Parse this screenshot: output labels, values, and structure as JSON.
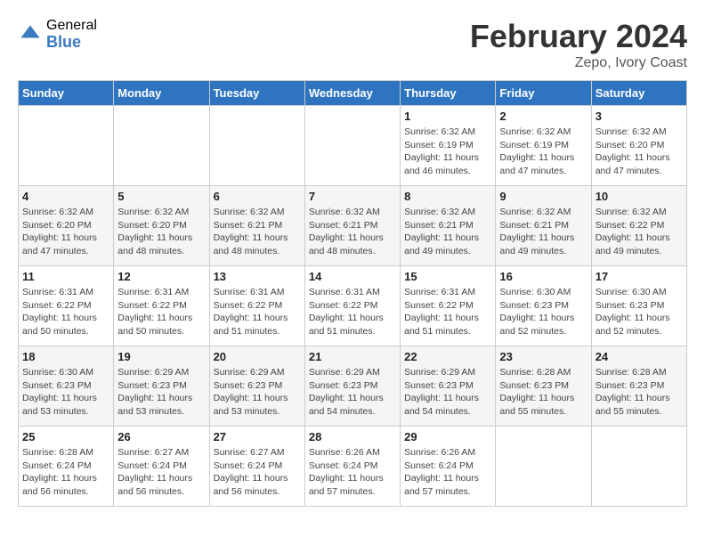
{
  "logo": {
    "general": "General",
    "blue": "Blue"
  },
  "title": {
    "month_year": "February 2024",
    "location": "Zepo, Ivory Coast"
  },
  "days_of_week": [
    "Sunday",
    "Monday",
    "Tuesday",
    "Wednesday",
    "Thursday",
    "Friday",
    "Saturday"
  ],
  "weeks": [
    [
      {
        "day": "",
        "sunrise": "",
        "sunset": "",
        "daylight": ""
      },
      {
        "day": "",
        "sunrise": "",
        "sunset": "",
        "daylight": ""
      },
      {
        "day": "",
        "sunrise": "",
        "sunset": "",
        "daylight": ""
      },
      {
        "day": "",
        "sunrise": "",
        "sunset": "",
        "daylight": ""
      },
      {
        "day": "1",
        "sunrise": "Sunrise: 6:32 AM",
        "sunset": "Sunset: 6:19 PM",
        "daylight": "Daylight: 11 hours and 46 minutes."
      },
      {
        "day": "2",
        "sunrise": "Sunrise: 6:32 AM",
        "sunset": "Sunset: 6:19 PM",
        "daylight": "Daylight: 11 hours and 47 minutes."
      },
      {
        "day": "3",
        "sunrise": "Sunrise: 6:32 AM",
        "sunset": "Sunset: 6:20 PM",
        "daylight": "Daylight: 11 hours and 47 minutes."
      }
    ],
    [
      {
        "day": "4",
        "sunrise": "Sunrise: 6:32 AM",
        "sunset": "Sunset: 6:20 PM",
        "daylight": "Daylight: 11 hours and 47 minutes."
      },
      {
        "day": "5",
        "sunrise": "Sunrise: 6:32 AM",
        "sunset": "Sunset: 6:20 PM",
        "daylight": "Daylight: 11 hours and 48 minutes."
      },
      {
        "day": "6",
        "sunrise": "Sunrise: 6:32 AM",
        "sunset": "Sunset: 6:21 PM",
        "daylight": "Daylight: 11 hours and 48 minutes."
      },
      {
        "day": "7",
        "sunrise": "Sunrise: 6:32 AM",
        "sunset": "Sunset: 6:21 PM",
        "daylight": "Daylight: 11 hours and 48 minutes."
      },
      {
        "day": "8",
        "sunrise": "Sunrise: 6:32 AM",
        "sunset": "Sunset: 6:21 PM",
        "daylight": "Daylight: 11 hours and 49 minutes."
      },
      {
        "day": "9",
        "sunrise": "Sunrise: 6:32 AM",
        "sunset": "Sunset: 6:21 PM",
        "daylight": "Daylight: 11 hours and 49 minutes."
      },
      {
        "day": "10",
        "sunrise": "Sunrise: 6:32 AM",
        "sunset": "Sunset: 6:22 PM",
        "daylight": "Daylight: 11 hours and 49 minutes."
      }
    ],
    [
      {
        "day": "11",
        "sunrise": "Sunrise: 6:31 AM",
        "sunset": "Sunset: 6:22 PM",
        "daylight": "Daylight: 11 hours and 50 minutes."
      },
      {
        "day": "12",
        "sunrise": "Sunrise: 6:31 AM",
        "sunset": "Sunset: 6:22 PM",
        "daylight": "Daylight: 11 hours and 50 minutes."
      },
      {
        "day": "13",
        "sunrise": "Sunrise: 6:31 AM",
        "sunset": "Sunset: 6:22 PM",
        "daylight": "Daylight: 11 hours and 51 minutes."
      },
      {
        "day": "14",
        "sunrise": "Sunrise: 6:31 AM",
        "sunset": "Sunset: 6:22 PM",
        "daylight": "Daylight: 11 hours and 51 minutes."
      },
      {
        "day": "15",
        "sunrise": "Sunrise: 6:31 AM",
        "sunset": "Sunset: 6:22 PM",
        "daylight": "Daylight: 11 hours and 51 minutes."
      },
      {
        "day": "16",
        "sunrise": "Sunrise: 6:30 AM",
        "sunset": "Sunset: 6:23 PM",
        "daylight": "Daylight: 11 hours and 52 minutes."
      },
      {
        "day": "17",
        "sunrise": "Sunrise: 6:30 AM",
        "sunset": "Sunset: 6:23 PM",
        "daylight": "Daylight: 11 hours and 52 minutes."
      }
    ],
    [
      {
        "day": "18",
        "sunrise": "Sunrise: 6:30 AM",
        "sunset": "Sunset: 6:23 PM",
        "daylight": "Daylight: 11 hours and 53 minutes."
      },
      {
        "day": "19",
        "sunrise": "Sunrise: 6:29 AM",
        "sunset": "Sunset: 6:23 PM",
        "daylight": "Daylight: 11 hours and 53 minutes."
      },
      {
        "day": "20",
        "sunrise": "Sunrise: 6:29 AM",
        "sunset": "Sunset: 6:23 PM",
        "daylight": "Daylight: 11 hours and 53 minutes."
      },
      {
        "day": "21",
        "sunrise": "Sunrise: 6:29 AM",
        "sunset": "Sunset: 6:23 PM",
        "daylight": "Daylight: 11 hours and 54 minutes."
      },
      {
        "day": "22",
        "sunrise": "Sunrise: 6:29 AM",
        "sunset": "Sunset: 6:23 PM",
        "daylight": "Daylight: 11 hours and 54 minutes."
      },
      {
        "day": "23",
        "sunrise": "Sunrise: 6:28 AM",
        "sunset": "Sunset: 6:23 PM",
        "daylight": "Daylight: 11 hours and 55 minutes."
      },
      {
        "day": "24",
        "sunrise": "Sunrise: 6:28 AM",
        "sunset": "Sunset: 6:23 PM",
        "daylight": "Daylight: 11 hours and 55 minutes."
      }
    ],
    [
      {
        "day": "25",
        "sunrise": "Sunrise: 6:28 AM",
        "sunset": "Sunset: 6:24 PM",
        "daylight": "Daylight: 11 hours and 56 minutes."
      },
      {
        "day": "26",
        "sunrise": "Sunrise: 6:27 AM",
        "sunset": "Sunset: 6:24 PM",
        "daylight": "Daylight: 11 hours and 56 minutes."
      },
      {
        "day": "27",
        "sunrise": "Sunrise: 6:27 AM",
        "sunset": "Sunset: 6:24 PM",
        "daylight": "Daylight: 11 hours and 56 minutes."
      },
      {
        "day": "28",
        "sunrise": "Sunrise: 6:26 AM",
        "sunset": "Sunset: 6:24 PM",
        "daylight": "Daylight: 11 hours and 57 minutes."
      },
      {
        "day": "29",
        "sunrise": "Sunrise: 6:26 AM",
        "sunset": "Sunset: 6:24 PM",
        "daylight": "Daylight: 11 hours and 57 minutes."
      },
      {
        "day": "",
        "sunrise": "",
        "sunset": "",
        "daylight": ""
      },
      {
        "day": "",
        "sunrise": "",
        "sunset": "",
        "daylight": ""
      }
    ]
  ]
}
